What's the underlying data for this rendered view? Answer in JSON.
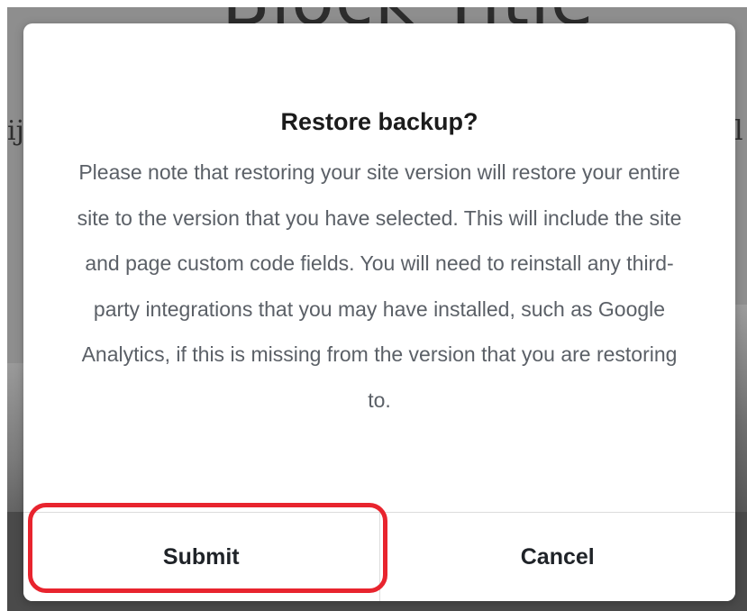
{
  "background_page": {
    "heading_fragment": "Block Title",
    "left_text_fragment": "ij",
    "right_text_fragment": "l"
  },
  "dialog": {
    "title": "Restore backup?",
    "message": "Please note that restoring your site version will restore your entire site to the version that you have selected. This will include the site and page custom code fields. You will need to reinstall any third-party integrations that you may have installed, such as Google Analytics, if this is missing from the version that you are restoring to.",
    "submit_label": "Submit",
    "cancel_label": "Cancel"
  },
  "annotation": {
    "highlight_color": "#e8242e",
    "highlighted_element": "submit-button"
  }
}
